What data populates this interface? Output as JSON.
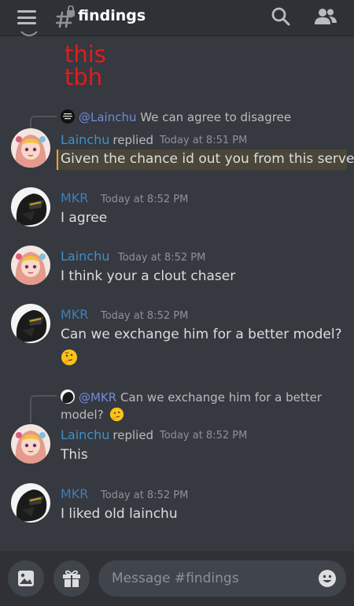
{
  "header": {
    "channel_name": "findings",
    "menu_icon": "hamburger-icon",
    "channel_icon": "locked-hash-icon",
    "search_icon": "search-icon",
    "members_icon": "members-icon"
  },
  "sticker_text": [
    "this",
    "tbh"
  ],
  "messages": [
    {
      "reply": {
        "mention": "@Lainchu",
        "text": "We can agree to disagree"
      },
      "author": "Lainchu",
      "replied_label": "replied",
      "timestamp": "Today at 8:51 PM",
      "text": "Given the chance id out you from this server",
      "highlighted": true
    },
    {
      "author": "MKR",
      "timestamp": "Today at 8:52 PM",
      "text": "I agree"
    },
    {
      "author": "Lainchu",
      "timestamp": "Today at 8:52 PM",
      "text": "I think your a clout chaser"
    },
    {
      "author": "MKR",
      "timestamp": "Today at 8:52 PM",
      "text": "Can we exchange him for a better model?",
      "emoji": "thinking-face"
    },
    {
      "reply": {
        "mention": "@MKR",
        "text_line1": "Can we exchange him for a better",
        "text_line2": "model?"
      },
      "author": "Lainchu",
      "replied_label": "replied",
      "timestamp": "Today at 8:52 PM",
      "text": "This"
    },
    {
      "author": "MKR",
      "timestamp": "Today at 8:52 PM",
      "text": "I liked old lainchu"
    }
  ],
  "composer": {
    "placeholder": "Message #findings",
    "image_icon": "image-icon",
    "gift_icon": "gift-icon",
    "emoji_icon": "smiley-icon"
  },
  "colors": {
    "background": "#36393f",
    "bar": "#2f3136",
    "name_blue": "#3f8fc9",
    "mention": "#7289da",
    "sticker_red": "#e51b1b",
    "highlight_border": "#faa61a"
  }
}
